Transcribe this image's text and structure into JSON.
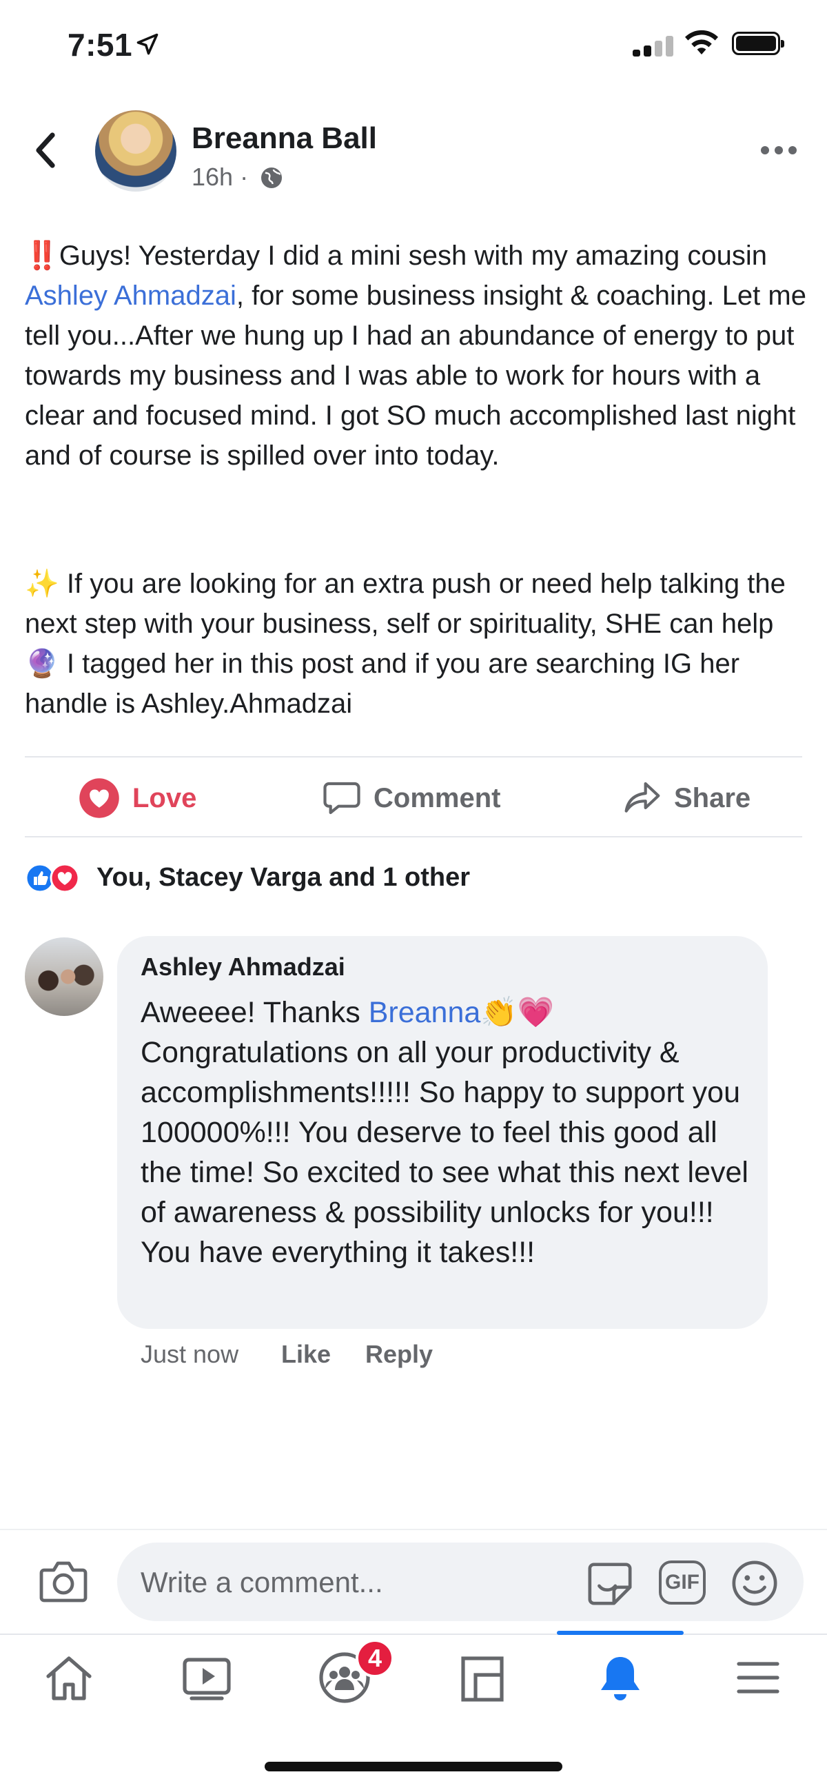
{
  "status_bar": {
    "time": "7:51"
  },
  "post": {
    "author": "Breanna Ball",
    "time_ago": "16h",
    "separator": "·",
    "paragraph1": {
      "emoji_start": "‼️",
      "before_link": "Guys! Yesterday I did a mini sesh with my amazing cousin ",
      "link": "Ashley Ahmadzai",
      "after_link": ", for some business insight & coaching. Let me tell you...After we hung up I had an abundance of energy to put towards my business and I was able to work for hours with a clear and focused mind. I got SO much accomplished last night and of course is spilled over into today."
    },
    "paragraph2": {
      "emoji_start": "✨",
      "text_a": " If you are looking for an extra push or need help talking the next step with your business, self or spirituality, SHE can help ",
      "emoji_mid": "🔮",
      "text_b": " I tagged her in this post and if you are searching IG her handle is Ashley.Ahmadzai"
    }
  },
  "actions": {
    "love": "Love",
    "comment": "Comment",
    "share": "Share"
  },
  "reactions": {
    "summary": "You, Stacey Varga and 1 other"
  },
  "comment": {
    "author": "Ashley Ahmadzai",
    "text_before": "Aweeee! Thanks ",
    "mention": "Breanna",
    "emojis": "👏💗",
    "text_after": "Congratulations on all your productivity & accomplishments!!!!! So happy to support you 100000%!!! You deserve to feel this good all the time! So excited to see what this next level of awareness & possibility unlocks for you!!! You have everything it takes!!!",
    "time": "Just now",
    "like": "Like",
    "reply": "Reply"
  },
  "composer": {
    "placeholder": "Write a comment...",
    "gif_label": "GIF"
  },
  "tabbar": {
    "active_tab": "notifications",
    "groups_badge": "4",
    "icons": [
      "home-icon",
      "video-icon",
      "groups-icon",
      "pages-icon",
      "bell-icon",
      "menu-icon"
    ],
    "active_color": "#1877f2"
  },
  "colors": {
    "link": "#3b6fd8",
    "love": "#e0445a",
    "muted": "#65676b",
    "bubble": "#f0f2f5"
  }
}
